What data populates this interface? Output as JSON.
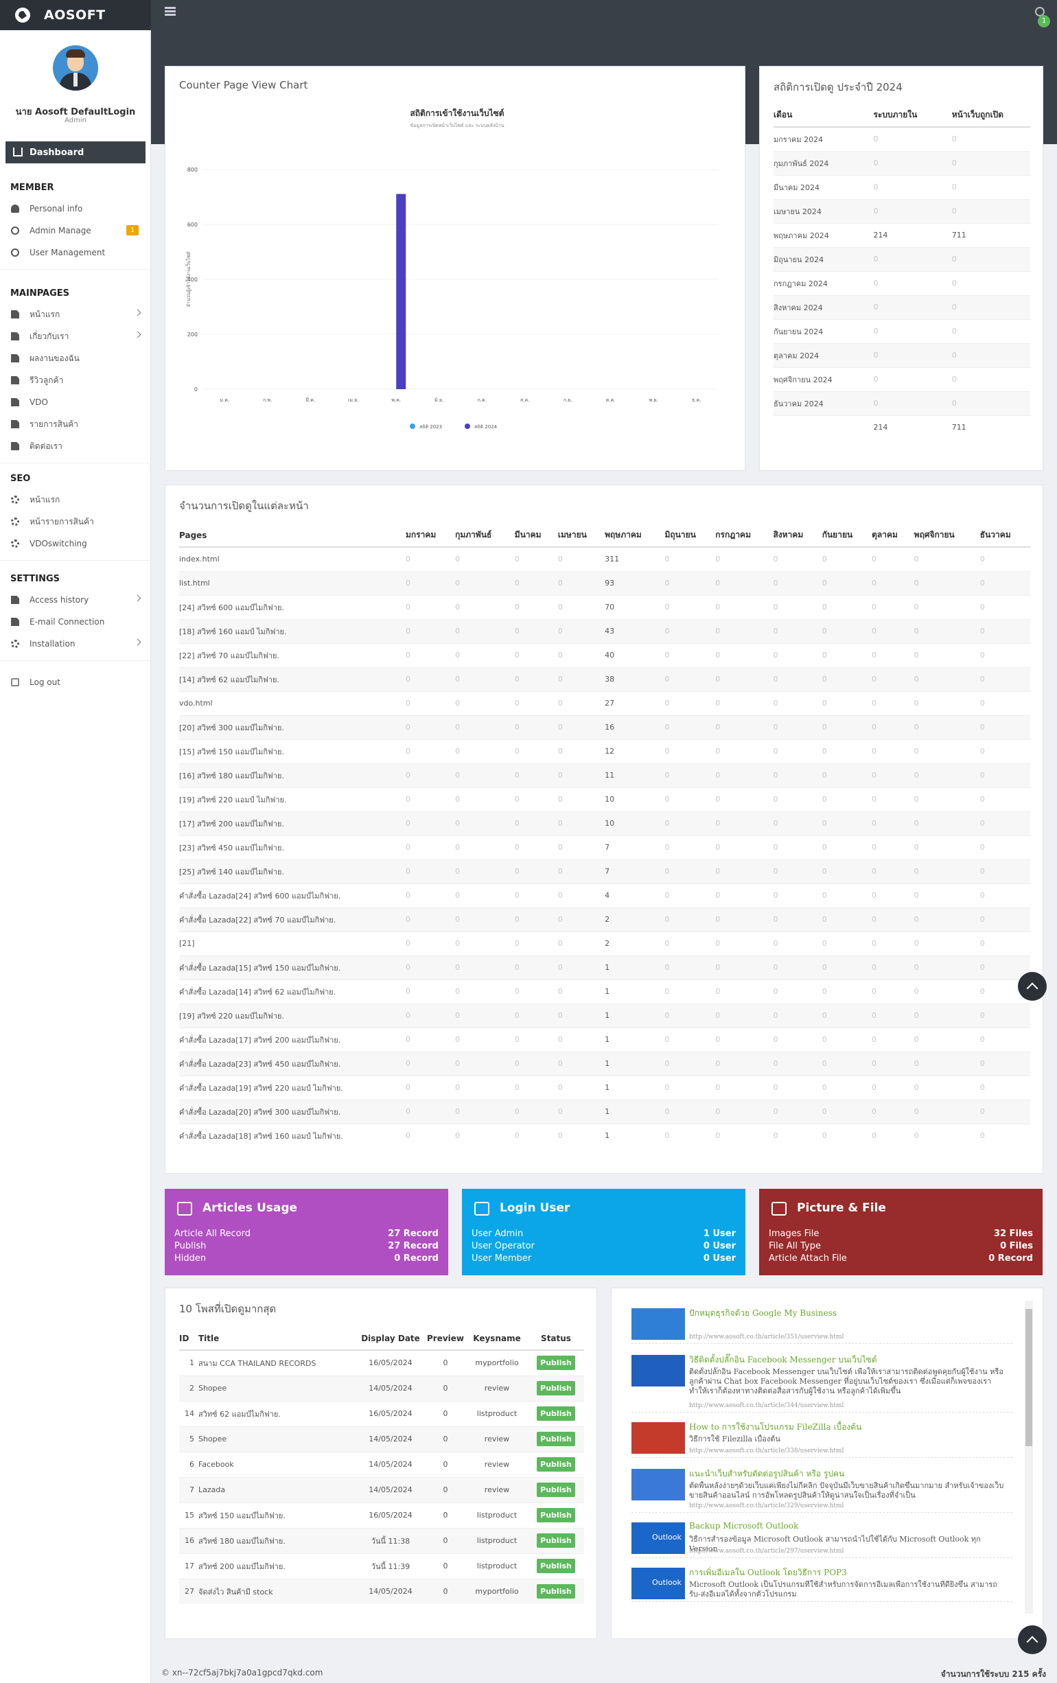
{
  "app": {
    "brand": "AOSOFT",
    "notif_count": "1"
  },
  "sidebar": {
    "user_name": "นาย Aosoft DefaultLogin",
    "user_role": "Admin",
    "dashboard": "Dashboard",
    "sections": [
      {
        "title": "MEMBER",
        "items": [
          {
            "label": "Personal info",
            "icon": "person-icon"
          },
          {
            "label": "Admin Manage",
            "icon": "user-circle-icon",
            "badge": "1"
          },
          {
            "label": "User Management",
            "icon": "user-circle-icon"
          }
        ]
      },
      {
        "title": "MAINPAGES",
        "items": [
          {
            "label": "หน้าแรก",
            "icon": "document-icon",
            "chevron": true
          },
          {
            "label": "เกี่ยวกับเรา",
            "icon": "document-icon",
            "chevron": true
          },
          {
            "label": "ผลงานของฉัน",
            "icon": "document-icon"
          },
          {
            "label": "รีวิวลูกค้า",
            "icon": "document-icon"
          },
          {
            "label": "VDO",
            "icon": "document-icon"
          },
          {
            "label": "รายการสินค้า",
            "icon": "document-icon"
          },
          {
            "label": "ติดต่อเรา",
            "icon": "document-icon"
          }
        ]
      },
      {
        "title": "SEO",
        "items": [
          {
            "label": "หน้าแรก",
            "icon": "gears-icon"
          },
          {
            "label": "หน้ารายการสินค้า",
            "icon": "gears-icon"
          },
          {
            "label": "VDOswitching",
            "icon": "gears-icon"
          }
        ]
      },
      {
        "title": "SETTINGS",
        "items": [
          {
            "label": "Access history",
            "icon": "document-icon",
            "chevron": true
          },
          {
            "label": "E-mail Connection",
            "icon": "document-icon"
          },
          {
            "label": "Installation",
            "icon": "gears-icon",
            "chevron": true
          }
        ]
      }
    ],
    "logout": "Log out"
  },
  "counter_panel": {
    "title": "Counter Page View Chart"
  },
  "chart_data": {
    "type": "bar",
    "title": "สถิติการเข้าใช้งานเว็บไซต์",
    "subtitle": "ข้อมูลการเปิดหน้าเว็บไซต์ และ ระบบหลังบ้าน",
    "ylabel": "จำนวนผู้เข้าใช้งานเว็บไซต์",
    "categories": [
      "ม.ค.",
      "ก.พ.",
      "มี.ค.",
      "เม.ย.",
      "พ.ค.",
      "มิ.ย.",
      "ก.ค.",
      "ส.ค.",
      "ก.ย.",
      "ต.ค.",
      "พ.ย.",
      "ธ.ค."
    ],
    "series": [
      {
        "name": "สถิติ 2023",
        "color": "#36a2eb",
        "values": [
          0,
          0,
          0,
          0,
          0,
          0,
          0,
          0,
          0,
          0,
          0,
          0
        ]
      },
      {
        "name": "สถิติ 2024",
        "color": "#4b3fc2",
        "values": [
          0,
          0,
          0,
          0,
          711,
          0,
          0,
          0,
          0,
          0,
          0,
          0
        ]
      }
    ],
    "ylim": [
      0,
      800
    ],
    "yticks": [
      "0",
      "200",
      "400",
      "600",
      "800"
    ],
    "legend": "bottom"
  },
  "yearstats": {
    "title": "สถิติการเปิดดู ประจำปี 2024",
    "headers": [
      "เดือน",
      "ระบบภายใน",
      "หน้าเว็บถูกเปิด"
    ],
    "rows": [
      [
        "มกราคม 2024",
        "0",
        "0"
      ],
      [
        "กุมภาพันธ์ 2024",
        "0",
        "0"
      ],
      [
        "มีนาคม 2024",
        "0",
        "0"
      ],
      [
        "เมษายน 2024",
        "0",
        "0"
      ],
      [
        "พฤษภาคม 2024",
        "214",
        "711"
      ],
      [
        "มิถุนายน 2024",
        "0",
        "0"
      ],
      [
        "กรกฎาคม 2024",
        "0",
        "0"
      ],
      [
        "สิงหาคม 2024",
        "0",
        "0"
      ],
      [
        "กันยายน 2024",
        "0",
        "0"
      ],
      [
        "ตุลาคม 2024",
        "0",
        "0"
      ],
      [
        "พฤศจิกายน 2024",
        "0",
        "0"
      ],
      [
        "ธันวาคม 2024",
        "0",
        "0"
      ],
      [
        "",
        "214",
        "711"
      ]
    ]
  },
  "pageviews": {
    "title": "จำนวนการเปิดดูในแต่ละหน้า",
    "headers": [
      "Pages",
      "มกราคม",
      "กุมภาพันธ์",
      "มีนาคม",
      "เมษายน",
      "พฤษภาคม",
      "มิถุนายน",
      "กรกฎาคม",
      "สิงหาคม",
      "กันยายน",
      "ตุลาคม",
      "พฤศจิกายน",
      "ธันวาคม"
    ],
    "rows": [
      {
        "page": "index.html",
        "may": "311"
      },
      {
        "page": "list.html",
        "may": "93"
      },
      {
        "page": "[24] สวิทซ์ 600 แอมป์ไมกิฟาย.",
        "may": "70"
      },
      {
        "page": "[18] สวิทซ์ 160 แอมป์ ไมกิฟาย.",
        "may": "43"
      },
      {
        "page": "[22] สวิทซ์ 70 แอมป์ไมกิฟาย.",
        "may": "40"
      },
      {
        "page": "[14] สวิทซ์ 62 แอมป์ไมกิฟาย.",
        "may": "38"
      },
      {
        "page": "vdo.html",
        "may": "27"
      },
      {
        "page": "[20] สวิทซ์ 300 แอมป์ไมกิฟาย.",
        "may": "16"
      },
      {
        "page": "[15] สวิทซ์ 150 แอมป์ไมกิฟาย.",
        "may": "12"
      },
      {
        "page": "[16] สวิทซ์ 180 แอมป์ไมกิฟาย.",
        "may": "11"
      },
      {
        "page": "[19] สวิทซ์ 220 แอมป์ ไมกิฟาย.",
        "may": "10"
      },
      {
        "page": "[17] สวิทซ์ 200 แอมป์ไมกิฟาย.",
        "may": "10"
      },
      {
        "page": "[23] สวิทซ์ 450 แอมป์ไมกิฟาย.",
        "may": "7"
      },
      {
        "page": "[25] สวิทซ์ 140 แอมป์ไมกิฟาย.",
        "may": "7"
      },
      {
        "page": "คำสั่งซื้อ Lazada[24] สวิทซ์ 600 แอมป์ไมกิฟาย.",
        "may": "4"
      },
      {
        "page": "คำสั่งซื้อ Lazada[22] สวิทซ์ 70 แอมป์ไมกิฟาย.",
        "may": "2"
      },
      {
        "page": "[21]",
        "may": "2"
      },
      {
        "page": "คำสั่งซื้อ Lazada[15] สวิทซ์ 150 แอมป์ไมกิฟาย.",
        "may": "1"
      },
      {
        "page": "คำสั่งซื้อ Lazada[14] สวิทซ์ 62 แอมป์ไมกิฟาย.",
        "may": "1"
      },
      {
        "page": "[19] สวิทซ์ 220 แอมป์ไมกิฟาย.",
        "may": "1"
      },
      {
        "page": "คำสั่งซื้อ Lazada[17] สวิทซ์ 200 แอมป์ไมกิฟาย.",
        "may": "1"
      },
      {
        "page": "คำสั่งซื้อ Lazada[23] สวิทซ์ 450 แอมป์ไมกิฟาย.",
        "may": "1"
      },
      {
        "page": "คำสั่งซื้อ Lazada[19] สวิทซ์ 220 แอมป์ ไมกิฟาย.",
        "may": "1"
      },
      {
        "page": "คำสั่งซื้อ Lazada[20] สวิทซ์ 300 แอมป์ไมกิฟาย.",
        "may": "1"
      },
      {
        "page": "คำสั่งซื้อ Lazada[18] สวิทซ์ 160 แอมป์ ไมกิฟาย.",
        "may": "1"
      }
    ]
  },
  "cards": [
    {
      "title": "Articles Usage",
      "color": "#b04fc1",
      "icon": "inbox-icon",
      "rows": [
        [
          "Article All Record",
          "27 Record"
        ],
        [
          "Publish",
          "27 Record"
        ],
        [
          "Hidden",
          "0 Record"
        ]
      ]
    },
    {
      "title": "Login User",
      "color": "#0aa6e8",
      "icon": "user-icon",
      "rows": [
        [
          "User Admin",
          "1 User"
        ],
        [
          "User Operator",
          "0 User"
        ],
        [
          "User Member",
          "0 User"
        ]
      ]
    },
    {
      "title": "Picture & File",
      "color": "#982b2b",
      "icon": "camera-icon",
      "rows": [
        [
          "Images File",
          "32 Files"
        ],
        [
          "File All Type",
          "0 Files"
        ],
        [
          "Article Attach File",
          "0 Record"
        ]
      ]
    }
  ],
  "topposts": {
    "title": "10 โพสที่เปิดดูมากสุด",
    "headers": [
      "ID",
      "Title",
      "Display Date",
      "Preview",
      "Keysname",
      "Status"
    ],
    "rows": [
      [
        "1",
        "สนาม CCA THAILAND RECORDS",
        "16/05/2024",
        "0",
        "myportfolio",
        "Publish"
      ],
      [
        "2",
        "Shopee",
        "14/05/2024",
        "0",
        "review",
        "Publish"
      ],
      [
        "14",
        "สวิทซ์ 62 แอมป์ไมกิฟาย.",
        "16/05/2024",
        "0",
        "listproduct",
        "Publish"
      ],
      [
        "5",
        "Shopee",
        "14/05/2024",
        "0",
        "review",
        "Publish"
      ],
      [
        "6",
        "Facebook",
        "14/05/2024",
        "0",
        "review",
        "Publish"
      ],
      [
        "7",
        "Lazada",
        "14/05/2024",
        "0",
        "review",
        "Publish"
      ],
      [
        "15",
        "สวิทซ์ 150 แอมป์ไมกิฟาย.",
        "16/05/2024",
        "0",
        "listproduct",
        "Publish"
      ],
      [
        "16",
        "สวิทซ์ 180 แอมป์ไมกิฟาย.",
        "วันนี้ 11:38",
        "0",
        "listproduct",
        "Publish"
      ],
      [
        "17",
        "สวิทซ์ 200 แอมป์ไมกิฟาย.",
        "วันนี้ 11:39",
        "0",
        "listproduct",
        "Publish"
      ],
      [
        "27",
        "จัดส่งไว สินค้ามี stock",
        "14/05/2024",
        "0",
        "myportfolio",
        "Publish"
      ]
    ]
  },
  "news": [
    {
      "title": "ปักหมุดธุรกิจด้วย Google My Business",
      "desc": "",
      "url": "http://www.aosoft.co.th/article/351/userview.html",
      "thumb": "#2f7fd6"
    },
    {
      "title": "วิธีติดตั้งปลั๊กอิน Facebook Messenger บนเว็บไซต์",
      "desc": "ติดตั้งปลั๊กอิน Facebook Messenger บนเว็บไซต์ เพื่อให้เราสามารถติดต่อพูดคุยกับผู้ใช้งาน หรือลูกค้าผ่าน Chat box Facebook Messenger ที่อยู่บนเว็บไซต์ของเรา ซึ่งเมื่อแต่ก็เพจของเราทำให้เราก็ต้องหาทางติดต่อสื่อสารกับผู้ใช้งาน หรือลูกค้าได้เพิ่มขึ้น",
      "url": "http://www.aosoft.co.th/article/344/userview.html",
      "thumb": "#1f5fbf"
    },
    {
      "title": "How to การใช้งานโปรแกรม FileZilla เบื้องต้น",
      "desc": "วิธีการใช้ Filezilla เบื้องต้น",
      "url": "http://www.aosoft.co.th/article/338/userview.html",
      "thumb": "#c43b2b"
    },
    {
      "title": "แนะนำเว็บสำหรับตัดต่อรูปสินค้า หรือ รูปคน",
      "desc": "ตัดพื้นหลังง่ายๆด้วยเว็บแค่เพียงไม่กี่คลิก ปัจจุบันมีเว็บขายสินค้าเกิดขึ้นมากมาย สำหรับเจ้าของเว็บขายสินค้าออนไลน์ การอัพโหลดรูปสินค้าให้ดูน่าสนใจเป็นเรื่องที่จำเป็น",
      "url": "http://www.aosoft.co.th/article/329/userview.html",
      "thumb": "#3a79d8"
    },
    {
      "title": "Backup Microsoft Outlook",
      "desc": "วิธีการสำรองข้อมูล Microsoft Outlook สามารถนำไปใช้ได้กับ Microsoft Outlook ทุก Version",
      "url": "http://www.aosoft.co.th/article/297/userview.html",
      "thumb": "#1b66c9"
    },
    {
      "title": "การเพิ่มอีเมลใน Outlook โดยวิธีการ POP3",
      "desc": "Microsoft Outlook เป็นโปรแกรมที่ใช้สำหรับการจัดการอีเมลเพื่อการใช้งานที่ดียิ่งขึ้น สามารถรับ-ส่งอีเมลได้ทั้งจากตัวโปรแกรม",
      "url": "",
      "thumb": "#1b66c9"
    }
  ],
  "outlook_label": "Outlook",
  "footer": {
    "copyright": "© xn--72cf5aj7bkj7a0a1gpcd7qkd.com",
    "usage": "จำนวนการใช้ระบบ 215 ครั้ง"
  }
}
